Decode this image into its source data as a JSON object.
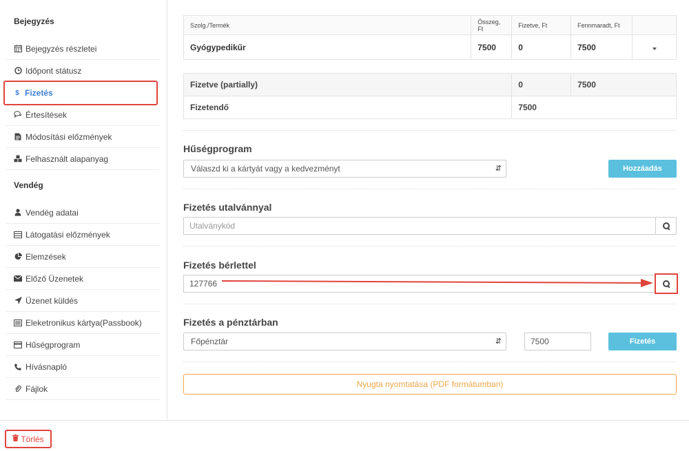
{
  "sidebar": {
    "section1_title": "Bejegyzés",
    "section1_items": [
      {
        "label": "Bejegyzés részletei",
        "icon": "calendar-icon"
      },
      {
        "label": "Időpont státusz",
        "icon": "clock-icon"
      },
      {
        "label": "Fizetés",
        "icon": "dollar-icon"
      },
      {
        "label": "Értesítések",
        "icon": "comments-icon"
      },
      {
        "label": "Módosítási előzmények",
        "icon": "file-icon"
      },
      {
        "label": "Felhasznált alapanyag",
        "icon": "cubes-icon"
      }
    ],
    "section2_title": "Vendég",
    "section2_items": [
      {
        "label": "Vendég adatai",
        "icon": "user-icon"
      },
      {
        "label": "Látogatási előzmények",
        "icon": "list-icon"
      },
      {
        "label": "Elemzések",
        "icon": "pie-chart-icon"
      },
      {
        "label": "Előző Üzenetek",
        "icon": "envelope-icon"
      },
      {
        "label": "Üzenet küldés",
        "icon": "send-icon"
      },
      {
        "label": "Eleketronikus kártya(Passbook)",
        "icon": "card-icon"
      },
      {
        "label": "Hűségprogram",
        "icon": "card-icon"
      },
      {
        "label": "Hívásnapló",
        "icon": "phone-icon"
      },
      {
        "label": "Fájlok",
        "icon": "paperclip-icon"
      }
    ]
  },
  "items_table": {
    "headers": [
      "Szolg./Termék",
      "Összeg, Ft",
      "Fizetve, Ft",
      "Fennmaradt, Ft"
    ],
    "rows": [
      {
        "name": "Gyógypedikűr",
        "amount": "7500",
        "paid": "0",
        "remaining": "7500"
      }
    ]
  },
  "summary": {
    "paid_label": "Fizetve (partially)",
    "paid_value": "0",
    "remaining_value": "7500",
    "due_label": "Fizetendő",
    "due_value": "7500"
  },
  "loyalty": {
    "title": "Hűségprogram",
    "select_value": "Válaszd ki a kártyát vagy a kedvezményt",
    "add_button": "Hozzáadás"
  },
  "voucher": {
    "title": "Fizetés utalvánnyal",
    "placeholder": "Utalványkód"
  },
  "pass": {
    "title": "Fizetés bérlettel",
    "value": "127766"
  },
  "cashier": {
    "title": "Fizetés a pénztárban",
    "select_value": "Főpénztár",
    "amount": "7500",
    "pay_button": "Fizetés"
  },
  "print_button": "Nyugta nyomtatása (PDF formátumban)",
  "delete_button": "Törlés",
  "colors": {
    "accent_blue": "#3b7fd4",
    "button_blue": "#5bc0de",
    "highlight_red": "#e0443b",
    "print_orange": "#f0a64a"
  }
}
